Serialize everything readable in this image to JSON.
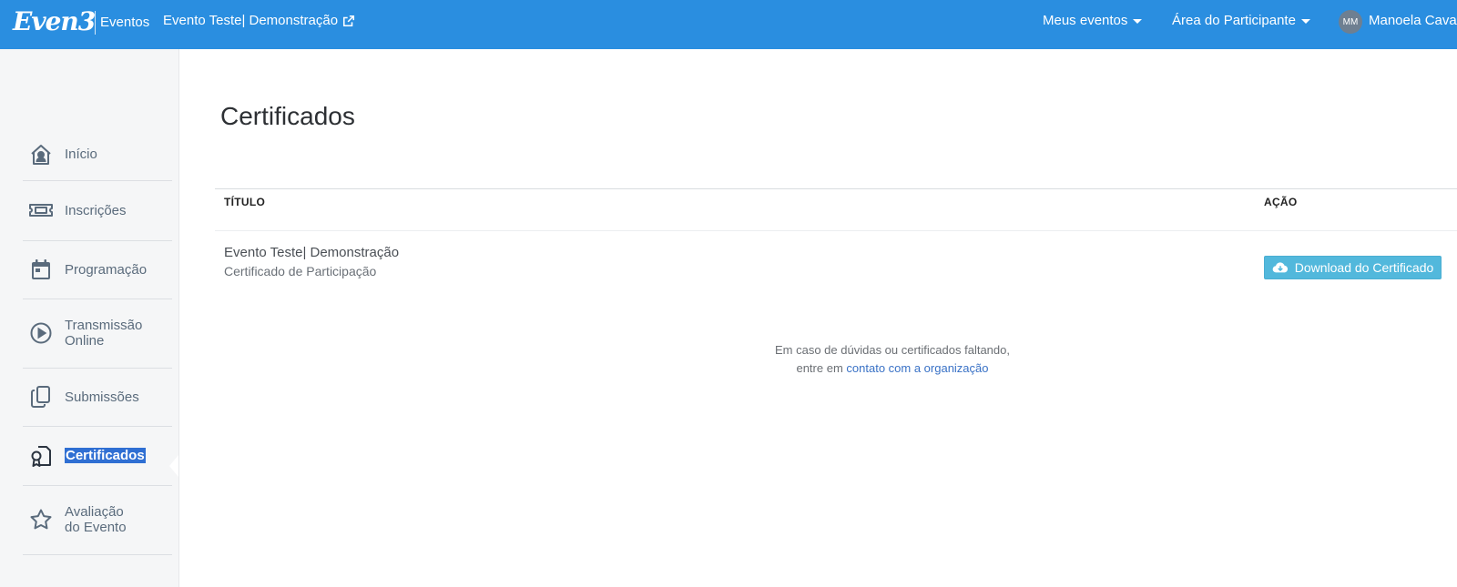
{
  "header": {
    "logo": "Even3",
    "logo_sub": "Eventos",
    "event_link": "Evento Teste| Demonstração",
    "menu_my_events": "Meus eventos",
    "menu_participant": "Área do Participante",
    "avatar_initials": "MM",
    "user_name": "Manoela Caval",
    "bar_color": "#2a8ee0"
  },
  "sidebar": {
    "items": [
      {
        "label": "Início",
        "icon": "home-user-icon"
      },
      {
        "label": "Inscrições",
        "icon": "ticket-icon"
      },
      {
        "label": "Programação",
        "icon": "calendar-icon"
      },
      {
        "label_line1": "Transmissão",
        "label_line2": "Online",
        "icon": "play-circle-icon"
      },
      {
        "label": "Submissões",
        "icon": "copy-documents-icon"
      },
      {
        "label": "Certificados",
        "icon": "certificate-icon",
        "active": true
      },
      {
        "label_line1": "Avaliação",
        "label_line2": "do Evento",
        "icon": "star-icon"
      }
    ],
    "active_highlight_color": "#2f6fd3"
  },
  "main": {
    "title": "Certificados",
    "table": {
      "headers": [
        "TÍTULO",
        "AÇÃO"
      ],
      "rows": [
        {
          "title": "Evento Teste| Demonstração",
          "subtitle": "Certificado de Participação",
          "action": "Download do Certificado"
        }
      ]
    },
    "help_line1": "Em caso de dúvidas ou certificados faltando,",
    "help_line2_prefix": "entre em",
    "help_link": "contato com a organização",
    "button_color": "#52b8dc"
  }
}
